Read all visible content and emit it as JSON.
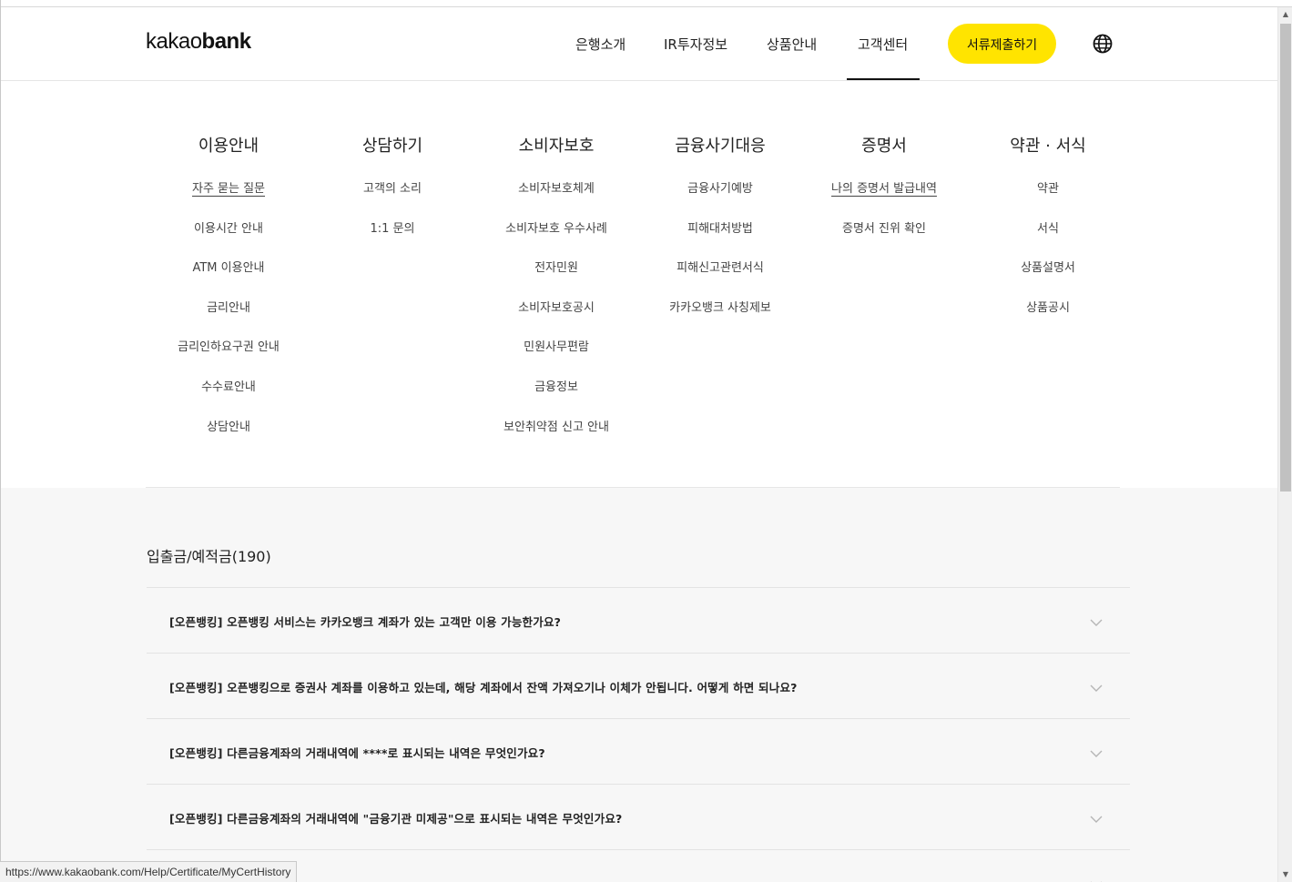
{
  "logo": {
    "regular": "kakao",
    "bold": "bank"
  },
  "nav": {
    "items": [
      "은행소개",
      "IR투자정보",
      "상품안내",
      "고객센터"
    ],
    "active": "고객센터",
    "cta_label": "서류제출하기"
  },
  "icons": {
    "language": "globe-icon",
    "expand": "chevron-down-icon"
  },
  "colors": {
    "accent": "#ffe400",
    "text": "#222222",
    "content_bg": "#f7f7f7"
  },
  "mega_menu": {
    "columns": [
      {
        "title": "이용안내",
        "links": [
          "자주 묻는 질문",
          "이용시간 안내",
          "ATM 이용안내",
          "금리안내",
          "금리인하요구권 안내",
          "수수료안내",
          "상담안내"
        ],
        "underlined": "자주 묻는 질문"
      },
      {
        "title": "상담하기",
        "links": [
          "고객의 소리",
          "1:1 문의"
        ]
      },
      {
        "title": "소비자보호",
        "links": [
          "소비자보호체계",
          "소비자보호 우수사례",
          "전자민원",
          "소비자보호공시",
          "민원사무편람",
          "금융정보",
          "보안취약점 신고 안내"
        ]
      },
      {
        "title": "금융사기대응",
        "links": [
          "금융사기예방",
          "피해대처방법",
          "피해신고관련서식",
          "카카오뱅크 사칭제보"
        ]
      },
      {
        "title": "증명서",
        "links": [
          "나의 증명서 발급내역",
          "증명서 진위 확인"
        ],
        "underlined": "나의 증명서 발급내역"
      },
      {
        "title": "약관 · 서식",
        "links": [
          "약관",
          "서식",
          "상품설명서",
          "상품공시"
        ]
      }
    ]
  },
  "faq": {
    "category_title": "입출금/예적금(190)",
    "items": [
      "[오픈뱅킹] 오픈뱅킹 서비스는 카카오뱅크 계좌가 있는 고객만 이용 가능한가요?",
      "[오픈뱅킹] 오픈뱅킹으로 증권사 계좌를 이용하고 있는데, 해당 계좌에서 잔액 가져오기나 이체가 안됩니다. 어떻게 하면 되나요?",
      "[오픈뱅킹] 다른금융계좌의 거래내역에 ****로 표시되는 내역은 무엇인가요?",
      "[오픈뱅킹] 다른금융계좌의 거래내역에 \"금융기관 미제공\"으로 표시되는 내역은 무엇인가요?"
    ]
  },
  "statusbar": {
    "url": "https://www.kakaobank.com/Help/Certificate/MyCertHistory"
  }
}
